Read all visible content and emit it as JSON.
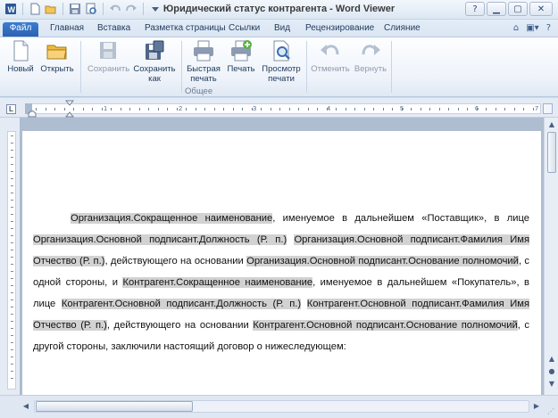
{
  "window": {
    "title": "Юридический статус контрагента - Word Viewer"
  },
  "tabs": [
    "Файл",
    "Главная",
    "Вставка",
    "Разметка страницы",
    "Ссылки",
    "Вид",
    "Рецензирование",
    "Слияние"
  ],
  "ribbon": {
    "buttons": [
      {
        "label": "Новый",
        "icon": "new-document-icon",
        "enabled": true
      },
      {
        "label": "Открыть",
        "icon": "folder-open-icon",
        "enabled": true
      },
      {
        "label": "Сохранить",
        "icon": "floppy-save-icon",
        "enabled": false
      },
      {
        "label": "Сохранить\nкак",
        "icon": "floppy-save-as-icon",
        "enabled": true
      },
      {
        "label": "Быстрая\nпечать",
        "icon": "printer-icon",
        "enabled": true
      },
      {
        "label": "Печать",
        "icon": "printer-options-icon",
        "enabled": true
      },
      {
        "label": "Просмотр\nпечати",
        "icon": "print-preview-icon",
        "enabled": true
      },
      {
        "label": "Отменить",
        "icon": "undo-icon",
        "enabled": false
      },
      {
        "label": "Вернуть",
        "icon": "redo-icon",
        "enabled": false
      }
    ],
    "group_label": "Общее"
  },
  "ruler": {
    "corner": "L",
    "numbers": [
      "1",
      "2",
      "3",
      "4",
      "5",
      "6",
      "7"
    ]
  },
  "document": {
    "paragraph": [
      {
        "t": "Организация.Сокращенное наименование",
        "f": true
      },
      {
        "t": ", именуемое в дальнейшем «Поставщик», в лице ",
        "f": false
      },
      {
        "t": "Организация.Основной подписант.Должность (Р. п.)",
        "f": true
      },
      {
        "t": " ",
        "f": false
      },
      {
        "t": "Организация.Основной подписант.Фамилия Имя Отчество (Р. п.)",
        "f": true
      },
      {
        "t": ", действующего на основании ",
        "f": false
      },
      {
        "t": "Организация.Основной подписант.Основание полномочий",
        "f": true
      },
      {
        "t": ", с одной стороны, и ",
        "f": false
      },
      {
        "t": "Контрагент.Сокращенное наименование",
        "f": true
      },
      {
        "t": ", именуемое в дальнейшем «Покупатель», в лице ",
        "f": false
      },
      {
        "t": "Контрагент.Основной подписант.Должность (Р. п.)",
        "f": true
      },
      {
        "t": " ",
        "f": false
      },
      {
        "t": "Контрагент.Основной подписант.Фамилия Имя Отчество (Р. п.)",
        "f": true
      },
      {
        "t": ", действующего на основании ",
        "f": false
      },
      {
        "t": "Контрагент.Основной подписант.Основание полномочий",
        "f": true
      },
      {
        "t": ", с другой стороны, заключили настоящий договор о нижеследующем:",
        "f": false
      }
    ]
  },
  "colors": {
    "file_tab": "#2a62b4",
    "field_highlight": "#d2d2d2",
    "workspace": "#aebdd0"
  }
}
